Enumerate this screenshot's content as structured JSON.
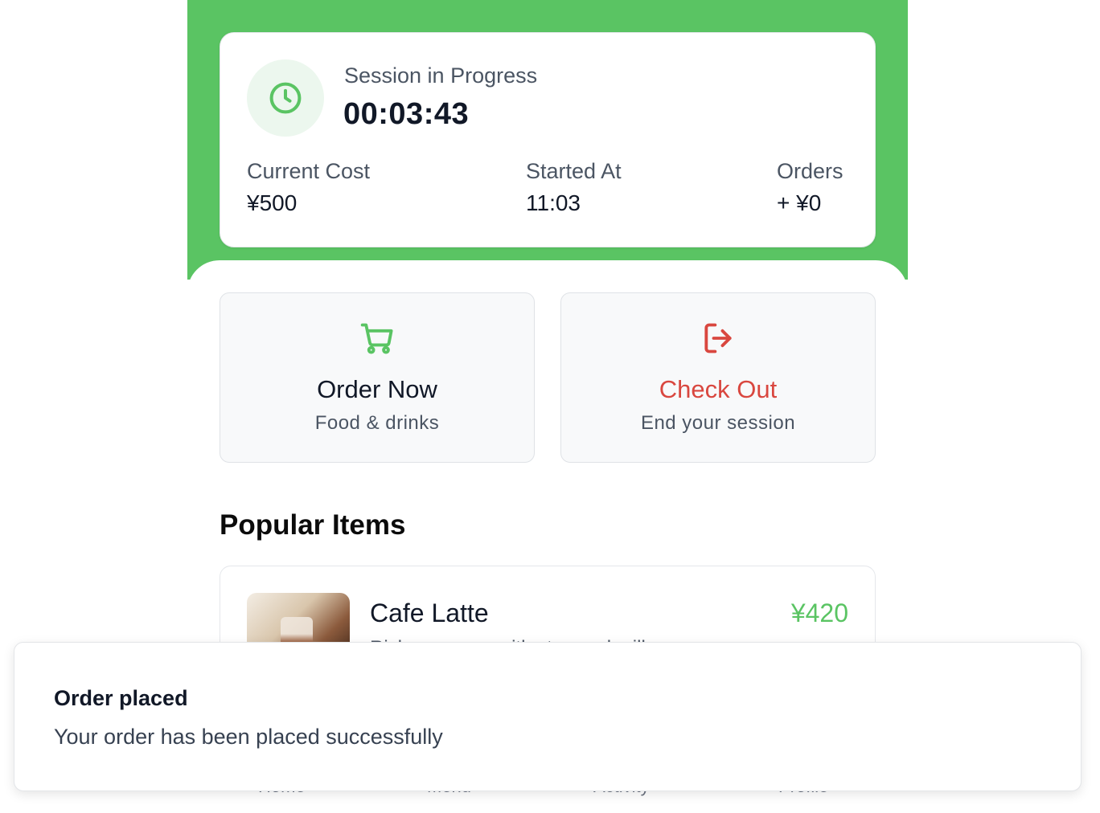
{
  "session": {
    "title": "Session in Progress",
    "timer": "00:03:43",
    "stats": [
      {
        "label": "Current Cost",
        "value": "¥500"
      },
      {
        "label": "Started At",
        "value": "11:03"
      },
      {
        "label": "Orders",
        "value": "+ ¥0"
      }
    ]
  },
  "actions": [
    {
      "title": "Order Now",
      "subtitle": "Food & drinks",
      "icon": "cart-icon",
      "color": "#5ac463"
    },
    {
      "title": "Check Out",
      "subtitle": "End your session",
      "icon": "logout-icon",
      "color": "#d9473f"
    }
  ],
  "popular": {
    "heading": "Popular Items",
    "items": [
      {
        "name": "Cafe Latte",
        "price": "¥420",
        "description": "Rich espresso with steamed milk"
      }
    ]
  },
  "nav": {
    "items": [
      "Home",
      "Menu",
      "Activity",
      "Profile"
    ]
  },
  "toast": {
    "title": "Order placed",
    "message": "Your order has been placed successfully"
  },
  "colors": {
    "brand": "#5ac463",
    "danger": "#d9473f"
  }
}
